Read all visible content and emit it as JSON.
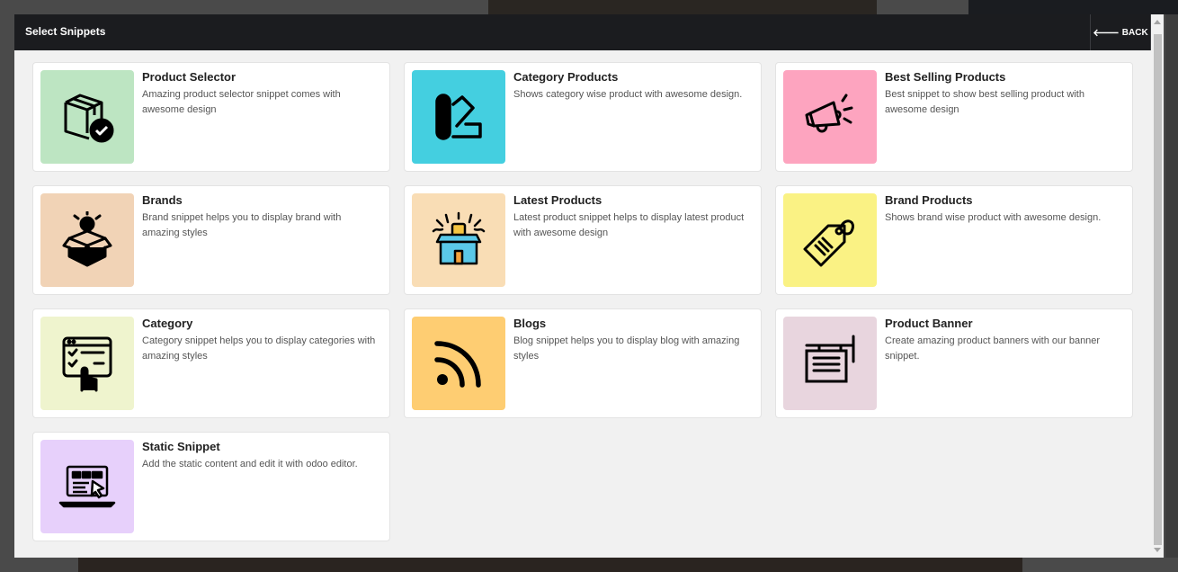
{
  "modal": {
    "title": "Select Snippets",
    "back_label": "BACK"
  },
  "snippets": [
    {
      "title": "Product Selector",
      "description": "Amazing product selector snippet comes with awesome design",
      "bg": "#bde5c2",
      "icon": "package-check-icon"
    },
    {
      "title": "Category Products",
      "description": "Shows category wise product with awesome design.",
      "bg": "#44cfe0",
      "icon": "color-swatch-icon"
    },
    {
      "title": "Best Selling Products",
      "description": "Best snippet to show best selling product with awesome design",
      "bg": "#fda4bf",
      "icon": "megaphone-icon"
    },
    {
      "title": "Brands",
      "description": "Brand snippet helps you to display brand with amazing styles",
      "bg": "#f1d3b6",
      "icon": "idea-box-icon"
    },
    {
      "title": "Latest Products",
      "description": "Latest product snippet helps to display latest product with awesome design",
      "bg": "#f9ddb5",
      "icon": "surprise-box-icon"
    },
    {
      "title": "Brand Products",
      "description": "Shows brand wise product with awesome design.",
      "bg": "#faf284",
      "icon": "price-tag-icon"
    },
    {
      "title": "Category",
      "description": "Category snippet helps you to display categories with amazing styles",
      "bg": "#eff4ce",
      "icon": "checklist-hand-icon"
    },
    {
      "title": "Blogs",
      "description": "Blog snippet helps you to display blog with amazing styles",
      "bg": "#fecd72",
      "icon": "rss-icon"
    },
    {
      "title": "Product Banner",
      "description": "Create amazing product banners with our banner snippet.",
      "bg": "#e8d5de",
      "icon": "signboard-icon"
    },
    {
      "title": "Static Snippet",
      "description": "Add the static content and edit it with odoo editor.",
      "bg": "#e7d0fb",
      "icon": "laptop-editor-icon"
    }
  ]
}
